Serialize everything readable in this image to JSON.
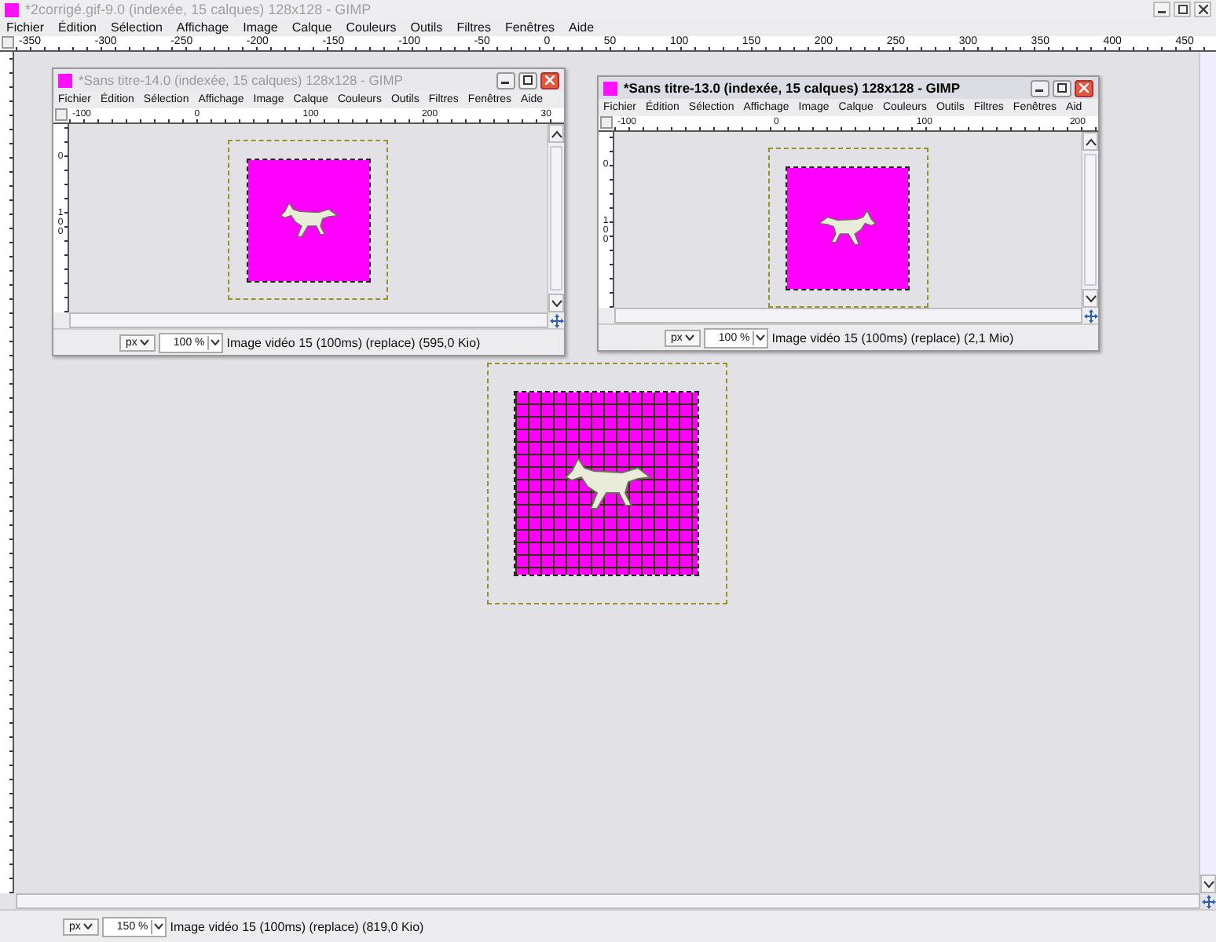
{
  "window": {
    "title": "*2corrigé.gif-9.0 (indexée, 15 calques) 128x128 - GIMP",
    "active": false
  },
  "menu": [
    "Fichier",
    "Édition",
    "Sélection",
    "Affichage",
    "Image",
    "Calque",
    "Couleurs",
    "Outils",
    "Filtres",
    "Fenêtres",
    "Aide"
  ],
  "ruler_labels": [
    "-350",
    "-300",
    "-250",
    "-200",
    "-150",
    "-100",
    "-50",
    "0",
    "50",
    "100",
    "150",
    "200",
    "250",
    "300",
    "350",
    "400",
    "450"
  ],
  "canvas": {
    "grid": true
  },
  "status": {
    "unit": "px",
    "zoom": "150 %",
    "message": "Image vidéo 15 (100ms) (replace) (819,0 Kio)"
  },
  "image_windows": [
    {
      "title": "*Sans titre-14.0 (indexée, 15 calques) 128x128 - GIMP",
      "active": false,
      "menu": [
        "Fichier",
        "Édition",
        "Sélection",
        "Affichage",
        "Image",
        "Calque",
        "Couleurs",
        "Outils",
        "Filtres",
        "Fenêtres",
        "Aide"
      ],
      "ruler_labels": [
        "-100",
        "0",
        "100",
        "200",
        "30"
      ],
      "vertical_ruler_labels": [
        "0",
        "100"
      ],
      "grid": false,
      "status": {
        "unit": "px",
        "zoom": "100 %",
        "message": "Image vidéo 15 (100ms) (replace) (595,0 Kio)"
      }
    },
    {
      "title": "*Sans titre-13.0 (indexée, 15 calques) 128x128 - GIMP",
      "active": true,
      "menu": [
        "Fichier",
        "Édition",
        "Sélection",
        "Affichage",
        "Image",
        "Calque",
        "Couleurs",
        "Outils",
        "Filtres",
        "Fenêtres",
        "Aid"
      ],
      "ruler_labels": [
        "-100",
        "0",
        "100",
        "200"
      ],
      "vertical_ruler_labels": [
        "0",
        "100"
      ],
      "grid": false,
      "status": {
        "unit": "px",
        "zoom": "100 %",
        "message": "Image vidéo 15 (100ms) (replace) (2,1 Mio)"
      }
    }
  ]
}
